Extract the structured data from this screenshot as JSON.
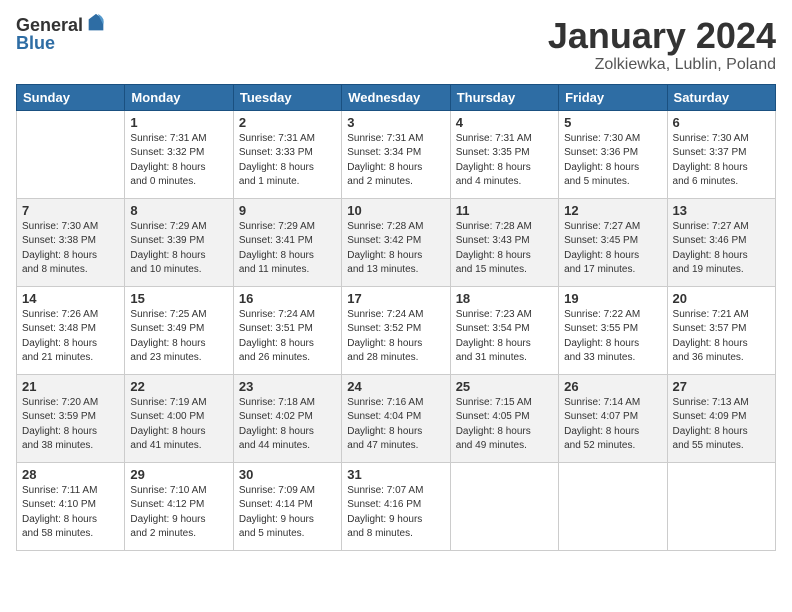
{
  "header": {
    "logo_general": "General",
    "logo_blue": "Blue",
    "title": "January 2024",
    "subtitle": "Zolkiewka, Lublin, Poland"
  },
  "weekdays": [
    "Sunday",
    "Monday",
    "Tuesday",
    "Wednesday",
    "Thursday",
    "Friday",
    "Saturday"
  ],
  "weeks": [
    [
      null,
      {
        "day": 1,
        "sunrise": "7:31 AM",
        "sunset": "3:32 PM",
        "daylight": "8 hours and 0 minutes."
      },
      {
        "day": 2,
        "sunrise": "7:31 AM",
        "sunset": "3:33 PM",
        "daylight": "8 hours and 1 minute."
      },
      {
        "day": 3,
        "sunrise": "7:31 AM",
        "sunset": "3:34 PM",
        "daylight": "8 hours and 2 minutes."
      },
      {
        "day": 4,
        "sunrise": "7:31 AM",
        "sunset": "3:35 PM",
        "daylight": "8 hours and 4 minutes."
      },
      {
        "day": 5,
        "sunrise": "7:30 AM",
        "sunset": "3:36 PM",
        "daylight": "8 hours and 5 minutes."
      },
      {
        "day": 6,
        "sunrise": "7:30 AM",
        "sunset": "3:37 PM",
        "daylight": "8 hours and 6 minutes."
      }
    ],
    [
      {
        "day": 7,
        "sunrise": "7:30 AM",
        "sunset": "3:38 PM",
        "daylight": "8 hours and 8 minutes."
      },
      {
        "day": 8,
        "sunrise": "7:29 AM",
        "sunset": "3:39 PM",
        "daylight": "8 hours and 10 minutes."
      },
      {
        "day": 9,
        "sunrise": "7:29 AM",
        "sunset": "3:41 PM",
        "daylight": "8 hours and 11 minutes."
      },
      {
        "day": 10,
        "sunrise": "7:28 AM",
        "sunset": "3:42 PM",
        "daylight": "8 hours and 13 minutes."
      },
      {
        "day": 11,
        "sunrise": "7:28 AM",
        "sunset": "3:43 PM",
        "daylight": "8 hours and 15 minutes."
      },
      {
        "day": 12,
        "sunrise": "7:27 AM",
        "sunset": "3:45 PM",
        "daylight": "8 hours and 17 minutes."
      },
      {
        "day": 13,
        "sunrise": "7:27 AM",
        "sunset": "3:46 PM",
        "daylight": "8 hours and 19 minutes."
      }
    ],
    [
      {
        "day": 14,
        "sunrise": "7:26 AM",
        "sunset": "3:48 PM",
        "daylight": "8 hours and 21 minutes."
      },
      {
        "day": 15,
        "sunrise": "7:25 AM",
        "sunset": "3:49 PM",
        "daylight": "8 hours and 23 minutes."
      },
      {
        "day": 16,
        "sunrise": "7:24 AM",
        "sunset": "3:51 PM",
        "daylight": "8 hours and 26 minutes."
      },
      {
        "day": 17,
        "sunrise": "7:24 AM",
        "sunset": "3:52 PM",
        "daylight": "8 hours and 28 minutes."
      },
      {
        "day": 18,
        "sunrise": "7:23 AM",
        "sunset": "3:54 PM",
        "daylight": "8 hours and 31 minutes."
      },
      {
        "day": 19,
        "sunrise": "7:22 AM",
        "sunset": "3:55 PM",
        "daylight": "8 hours and 33 minutes."
      },
      {
        "day": 20,
        "sunrise": "7:21 AM",
        "sunset": "3:57 PM",
        "daylight": "8 hours and 36 minutes."
      }
    ],
    [
      {
        "day": 21,
        "sunrise": "7:20 AM",
        "sunset": "3:59 PM",
        "daylight": "8 hours and 38 minutes."
      },
      {
        "day": 22,
        "sunrise": "7:19 AM",
        "sunset": "4:00 PM",
        "daylight": "8 hours and 41 minutes."
      },
      {
        "day": 23,
        "sunrise": "7:18 AM",
        "sunset": "4:02 PM",
        "daylight": "8 hours and 44 minutes."
      },
      {
        "day": 24,
        "sunrise": "7:16 AM",
        "sunset": "4:04 PM",
        "daylight": "8 hours and 47 minutes."
      },
      {
        "day": 25,
        "sunrise": "7:15 AM",
        "sunset": "4:05 PM",
        "daylight": "8 hours and 49 minutes."
      },
      {
        "day": 26,
        "sunrise": "7:14 AM",
        "sunset": "4:07 PM",
        "daylight": "8 hours and 52 minutes."
      },
      {
        "day": 27,
        "sunrise": "7:13 AM",
        "sunset": "4:09 PM",
        "daylight": "8 hours and 55 minutes."
      }
    ],
    [
      {
        "day": 28,
        "sunrise": "7:11 AM",
        "sunset": "4:10 PM",
        "daylight": "8 hours and 58 minutes."
      },
      {
        "day": 29,
        "sunrise": "7:10 AM",
        "sunset": "4:12 PM",
        "daylight": "9 hours and 2 minutes."
      },
      {
        "day": 30,
        "sunrise": "7:09 AM",
        "sunset": "4:14 PM",
        "daylight": "9 hours and 5 minutes."
      },
      {
        "day": 31,
        "sunrise": "7:07 AM",
        "sunset": "4:16 PM",
        "daylight": "9 hours and 8 minutes."
      },
      null,
      null,
      null
    ]
  ]
}
